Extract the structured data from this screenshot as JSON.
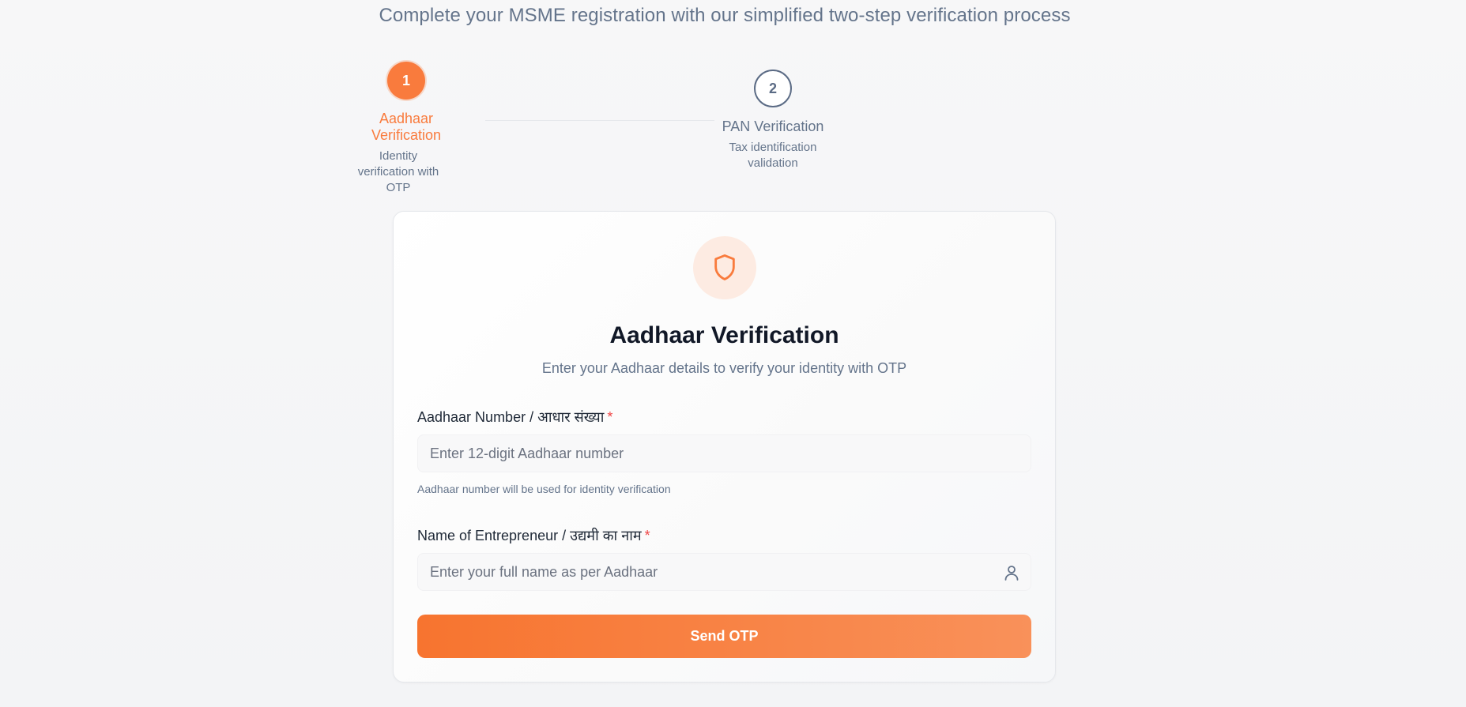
{
  "header": {
    "subtitle": "Complete your MSME registration with our simplified two-step verification process"
  },
  "steps": [
    {
      "number": "1",
      "title": "Aadhaar Verification",
      "description": "Identity verification with OTP",
      "state": "active"
    },
    {
      "number": "2",
      "title": "PAN Verification",
      "description": "Tax identification validation",
      "state": "inactive"
    }
  ],
  "card": {
    "icon": "shield-icon",
    "title": "Aadhaar Verification",
    "subtitle": "Enter your Aadhaar details to verify your identity with OTP",
    "fields": [
      {
        "label": "Aadhaar Number / आधार संख्या",
        "required_mark": "*",
        "placeholder": "Enter 12-digit Aadhaar number",
        "value": "",
        "helper": "Aadhaar number will be used for identity verification"
      },
      {
        "label": "Name of Entrepreneur / उद्यमी का नाम",
        "required_mark": "*",
        "placeholder": "Enter your full name as per Aadhaar",
        "value": "",
        "icon": "user-icon"
      }
    ],
    "submit_label": "Send OTP"
  },
  "colors": {
    "accent": "#f97b3d",
    "required": "#ef4444",
    "muted_text": "#64748b"
  }
}
